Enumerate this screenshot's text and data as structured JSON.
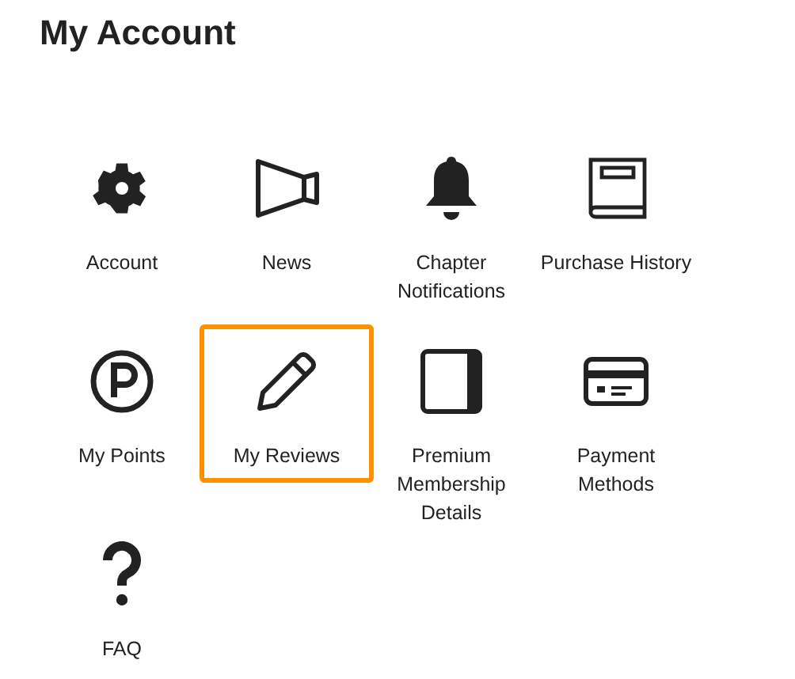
{
  "title": "My Account",
  "tiles": [
    {
      "label": "Account",
      "selected": false
    },
    {
      "label": "News",
      "selected": false
    },
    {
      "label": "Chapter Notifications",
      "selected": false
    },
    {
      "label": "Purchase History",
      "selected": false
    },
    {
      "label": "My Points",
      "selected": false
    },
    {
      "label": "My Reviews",
      "selected": true
    },
    {
      "label": "Premium Membership Details",
      "selected": false
    },
    {
      "label": "Payment Methods",
      "selected": false
    },
    {
      "label": "FAQ",
      "selected": false
    }
  ]
}
